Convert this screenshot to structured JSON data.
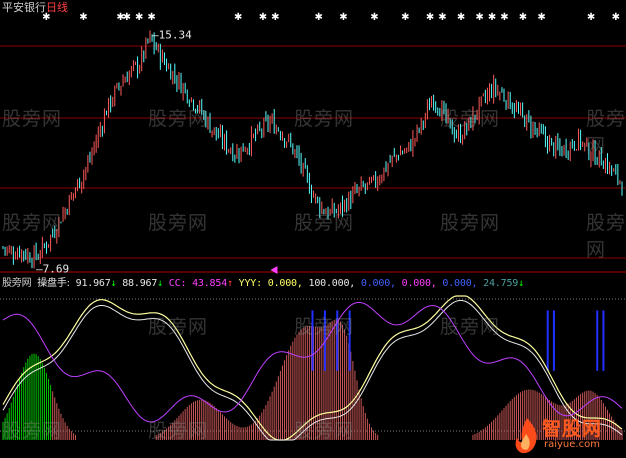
{
  "title": {
    "stock": "平安银行",
    "period": "日线"
  },
  "price": {
    "high_label": "15.34",
    "low_label": "7.69",
    "y_range": [
      7.2,
      16.2
    ],
    "closes": [
      8.0,
      7.8,
      7.9,
      7.7,
      7.69,
      8.1,
      8.6,
      9.2,
      9.8,
      10.4,
      11.0,
      11.9,
      12.8,
      13.4,
      13.9,
      14.2,
      14.5,
      15.34,
      14.9,
      14.4,
      14.0,
      13.6,
      13.2,
      12.8,
      12.3,
      11.9,
      11.6,
      11.3,
      11.5,
      11.8,
      12.1,
      12.4,
      12.2,
      11.8,
      11.3,
      10.6,
      9.9,
      9.4,
      9.2,
      9.3,
      9.6,
      9.9,
      10.1,
      10.2,
      10.6,
      11.0,
      11.3,
      11.4,
      11.9,
      12.5,
      13.3,
      12.8,
      12.2,
      11.9,
      12.2,
      12.7,
      13.2,
      13.6,
      13.4,
      13.1,
      12.7,
      12.4,
      12.1,
      11.8,
      11.5,
      11.4,
      11.6,
      11.8,
      11.4,
      11.2,
      11.0,
      10.6,
      10.3
    ]
  },
  "markers": {
    "stars_top": [
      7,
      13,
      19,
      20,
      22,
      24,
      38,
      42,
      44,
      51,
      55,
      60,
      65,
      69,
      71,
      74,
      77,
      79,
      81,
      84,
      87,
      95,
      99
    ],
    "triangle_x": 0.432
  },
  "indicator": {
    "name": "操盘手:",
    "values": [
      {
        "text": "91.967",
        "arrow": "↓",
        "color": "#e8e8e8",
        "arrow_color": "#00ff00"
      },
      {
        "text": "88.967",
        "arrow": "↓",
        "color": "#e8e8e8",
        "arrow_color": "#00ff00"
      },
      {
        "text": "CC: 43.854",
        "arrow": "↑",
        "color": "#ff40ff",
        "arrow_color": "#ff4040"
      },
      {
        "text": "YYY: 0.000,",
        "arrow": "",
        "color": "#ffff66",
        "arrow_color": ""
      },
      {
        "text": "100.000,",
        "arrow": "",
        "color": "#e8e8e8",
        "arrow_color": ""
      },
      {
        "text": "0.000,",
        "arrow": "",
        "color": "#4060ff",
        "arrow_color": ""
      },
      {
        "text": "0.000,",
        "arrow": "",
        "color": "#ff40ff",
        "arrow_color": ""
      },
      {
        "text": "0.000,",
        "arrow": "",
        "color": "#4060ff",
        "arrow_color": ""
      },
      {
        "text": "24.759",
        "arrow": "↓",
        "color": "#4fa0a0",
        "arrow_color": "#00ff00"
      }
    ]
  },
  "watermark": "股旁网",
  "logo": {
    "main": "智股网",
    "sub": "raiyue.com"
  },
  "colors": {
    "up": "#ff5a5a",
    "down": "#54ffff",
    "grid": "#8b0000",
    "yellow": "#ffffa0",
    "white": "#e8e8e8",
    "magenta": "#c040ff",
    "blue": "#2030ff",
    "green": "#00ff00",
    "pink": "#ff7070"
  }
}
